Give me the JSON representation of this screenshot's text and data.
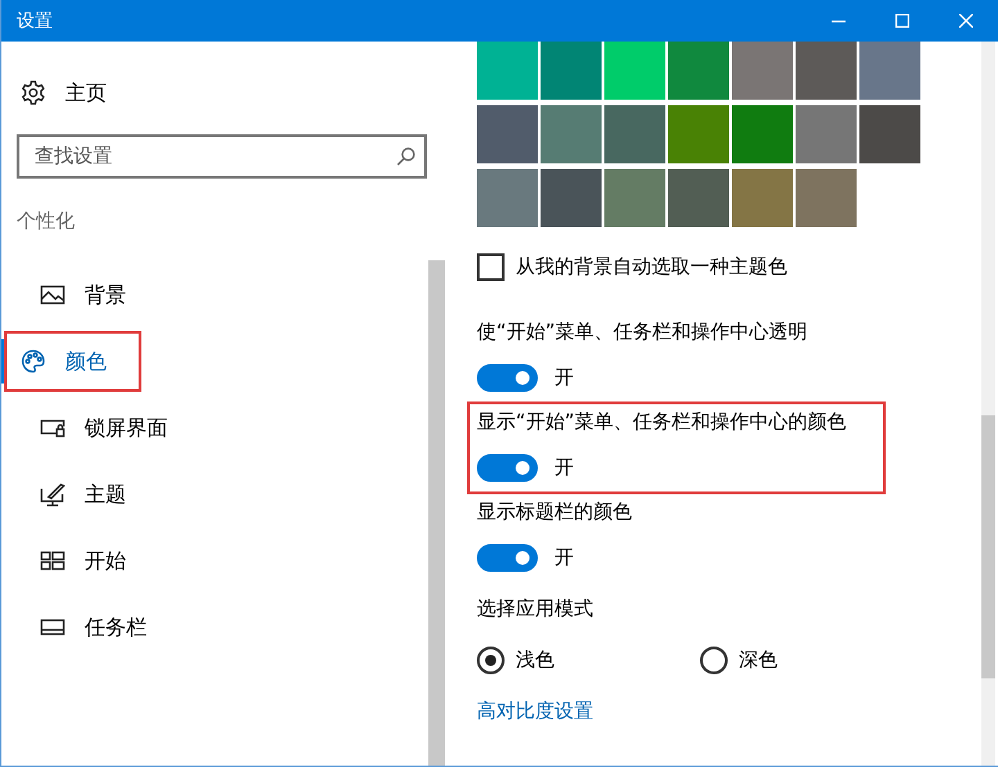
{
  "window": {
    "title": "设置"
  },
  "sidebar": {
    "home": "主页",
    "search": {
      "placeholder": "查找设置"
    },
    "section": "个性化",
    "items": [
      {
        "label": "背景",
        "selected": false,
        "highlighted": false
      },
      {
        "label": "颜色",
        "selected": true,
        "highlighted": true
      },
      {
        "label": "锁屏界面",
        "selected": false,
        "highlighted": false
      },
      {
        "label": "主题",
        "selected": false,
        "highlighted": false
      },
      {
        "label": "开始",
        "selected": false,
        "highlighted": false
      },
      {
        "label": "任务栏",
        "selected": false,
        "highlighted": false
      }
    ]
  },
  "swatches": [
    {
      "color": "#00b294"
    },
    {
      "color": "#018574"
    },
    {
      "color": "#00cc6a"
    },
    {
      "color": "#10893e"
    },
    {
      "color": "#7a7574"
    },
    {
      "color": "#5d5a58"
    },
    {
      "color": "#68768a"
    },
    {
      "color": "#515c6b"
    },
    {
      "color": "#567c73"
    },
    {
      "color": "#486860"
    },
    {
      "color": "#498205"
    },
    {
      "color": "#107c10"
    },
    {
      "color": "#767676"
    },
    {
      "color": "#4c4a48"
    },
    {
      "color": "#69797e"
    },
    {
      "color": "#4a5459"
    },
    {
      "color": "#647c64"
    },
    {
      "color": "#525e54"
    },
    {
      "color": "#847545"
    },
    {
      "color": "#7e735f"
    }
  ],
  "auto_color": {
    "label": "从我的背景自动选取一种主题色",
    "checked": false
  },
  "toggles": [
    {
      "label": "使“开始”菜单、任务栏和操作中心透明",
      "on": true,
      "state": "开",
      "highlighted": false
    },
    {
      "label": "显示“开始”菜单、任务栏和操作中心的颜色",
      "on": true,
      "state": "开",
      "highlighted": true
    },
    {
      "label": "显示标题栏的颜色",
      "on": true,
      "state": "开",
      "highlighted": false
    }
  ],
  "app_mode": {
    "label": "选择应用模式",
    "options": [
      {
        "label": "浅色",
        "selected": true
      },
      {
        "label": "深色",
        "selected": false
      }
    ]
  },
  "link": "高对比度设置"
}
